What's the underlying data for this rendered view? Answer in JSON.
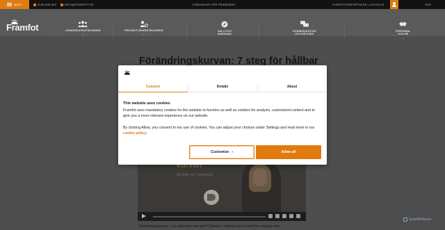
{
  "topbar": {
    "menu_label": "MENY",
    "phone": "0155-845 545",
    "email": "INFO@FRAMFOT.SE",
    "tagline": "UTBILDNING FÖR FRAMGÅNG",
    "links": "KOMPETENSPORTALEN  |  LOGGA IN",
    "search_label": "SÖK"
  },
  "nav": {
    "logo": "Framfot",
    "items": [
      {
        "line1": "LEDARSKAPSUTBILDNING",
        "line2": ""
      },
      {
        "line1": "PROJEKTLEDARUTBILDNING",
        "line2": ""
      },
      {
        "line1": "SÄLJ OCH",
        "line2": "MARKNAD"
      },
      {
        "line1": "KOMMUNIKATION",
        "line2": "OCH RETORIK"
      },
      {
        "line1": "PERSONAL",
        "line2": "OCH HR"
      }
    ]
  },
  "article": {
    "title": "Förändringskurvan: 7 steg för hållbar",
    "video_title": "kurvan",
    "video_subtitle": "Så leder du i förändring",
    "caption": "Förändringskurvan – hur påverkar man den? Daniela i Hjalmas Eva Krönel här redogör drar"
  },
  "cookie": {
    "tabs": [
      "Consent",
      "Details",
      "About"
    ],
    "title": "This website uses cookies",
    "para1": "Framfot uses mandatory cookies for the website to function as well as cookies for analysis, customized content and to give you a more relevant experience on our website.",
    "para2": "By clicking Allow, you consent to our use of cookies. You can adjust your choices under Settings and read more in our",
    "policy_link": "cookie policy",
    "customize_label": "Customize",
    "allow_label": "Allow all"
  },
  "watermark": "ScanMeAware",
  "colors": {
    "accent": "#e07b10",
    "topbar": "#121212",
    "nav": "#5a5a5a"
  }
}
